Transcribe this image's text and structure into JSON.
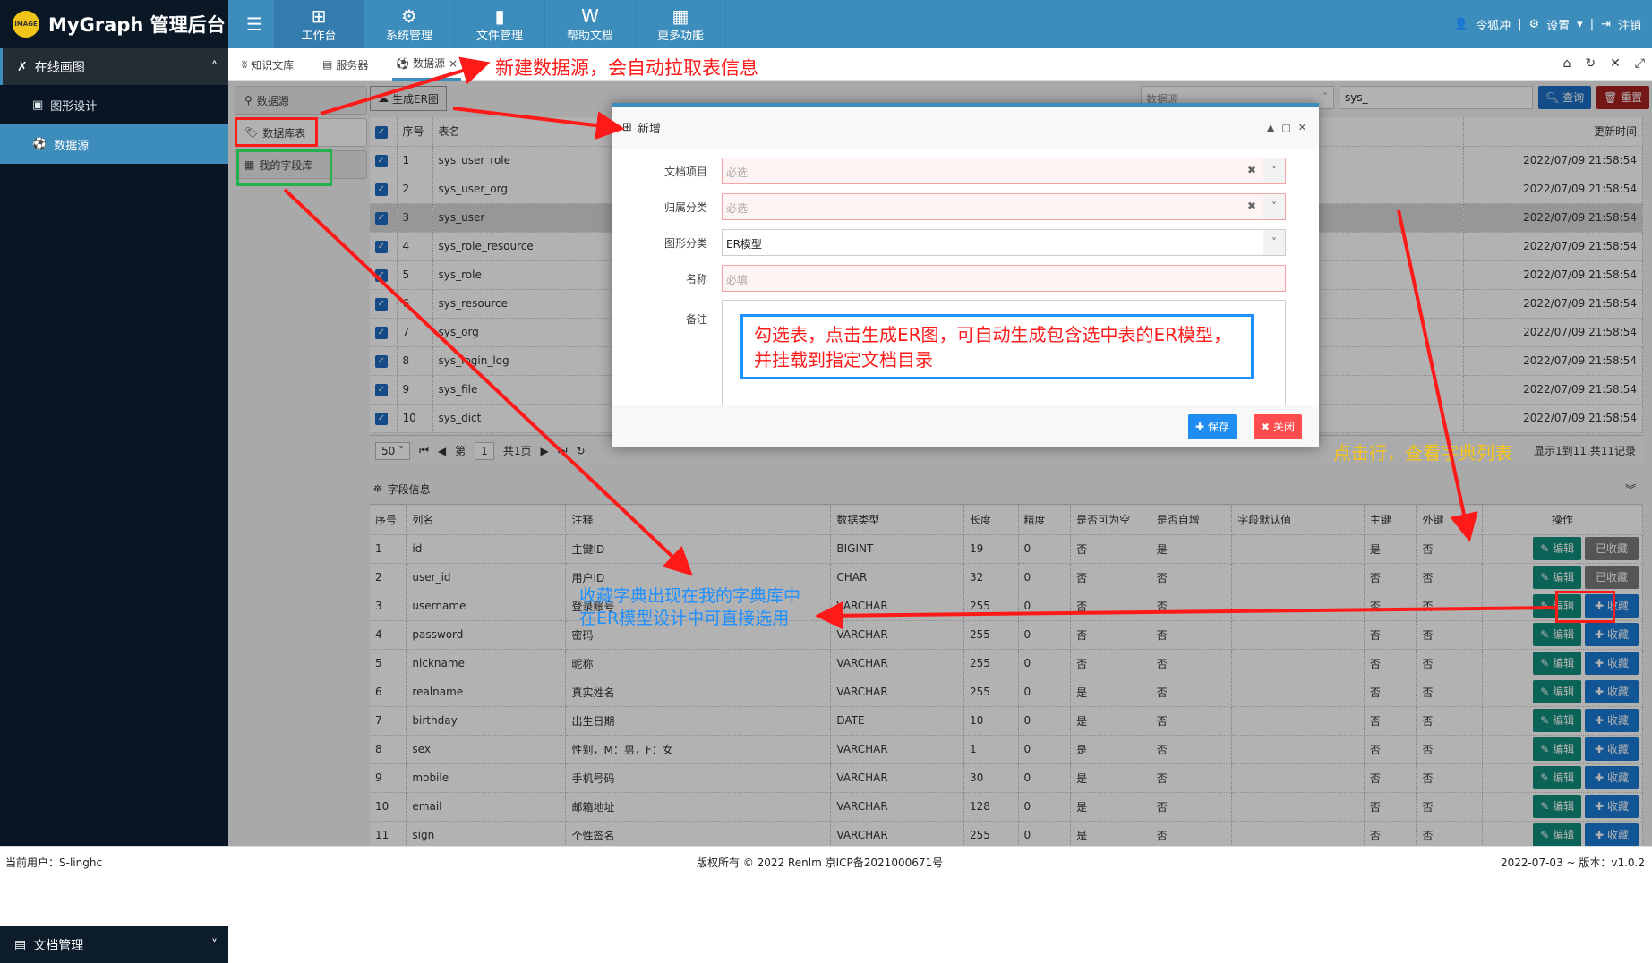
{
  "app": {
    "title": "MyGraph 管理后台",
    "logo_text": "IMAGE"
  },
  "topnav": [
    {
      "label": "工作台",
      "icon": "windows-icon"
    },
    {
      "label": "系统管理",
      "icon": "gear-icon"
    },
    {
      "label": "文件管理",
      "icon": "file-icon"
    },
    {
      "label": "帮助文档",
      "icon": "word-doc-icon"
    },
    {
      "label": "更多功能",
      "icon": "grid-icon"
    }
  ],
  "userbar": {
    "user": "令狐冲",
    "settings": "设置",
    "logout": "注销"
  },
  "sidebar": {
    "section": "在线画图",
    "items": [
      "图形设计",
      "数据源"
    ],
    "bottom": "文档管理"
  },
  "tabs": [
    {
      "label": "知识文库"
    },
    {
      "label": "服务器"
    },
    {
      "label": "数据源"
    }
  ],
  "lefttabs": [
    "数据源",
    "数据库表",
    "我的字段库"
  ],
  "toolbar": {
    "gen_er": "生成ER图",
    "ds_placeholder": "数据源",
    "search_value": "sys_",
    "query": "查询",
    "reset": "重置"
  },
  "table_cols": {
    "no": "序号",
    "name": "表名",
    "updated": "更新时间"
  },
  "tables": [
    {
      "no": "1",
      "name": "sys_user_role",
      "updated": "2022/07/09 21:58:54"
    },
    {
      "no": "2",
      "name": "sys_user_org",
      "updated": "2022/07/09 21:58:54"
    },
    {
      "no": "3",
      "name": "sys_user",
      "updated": "2022/07/09 21:58:54"
    },
    {
      "no": "4",
      "name": "sys_role_resource",
      "updated": "2022/07/09 21:58:54"
    },
    {
      "no": "5",
      "name": "sys_role",
      "updated": "2022/07/09 21:58:54"
    },
    {
      "no": "6",
      "name": "sys_resource",
      "updated": "2022/07/09 21:58:54"
    },
    {
      "no": "7",
      "name": "sys_org",
      "updated": "2022/07/09 21:58:54"
    },
    {
      "no": "8",
      "name": "sys_login_log",
      "updated": "2022/07/09 21:58:54"
    },
    {
      "no": "9",
      "name": "sys_file",
      "updated": "2022/07/09 21:58:54"
    },
    {
      "no": "10",
      "name": "sys_dict",
      "updated": "2022/07/09 21:58:54"
    }
  ],
  "pager": {
    "size": "50",
    "page_prefix": "第",
    "page": "1",
    "total": "共1页",
    "summary": "显示1到11,共11记录"
  },
  "fields_title": "字段信息",
  "field_cols": [
    "序号",
    "列名",
    "注释",
    "数据类型",
    "长度",
    "精度",
    "是否可为空",
    "是否自增",
    "字段默认值",
    "主键",
    "外键",
    "操作"
  ],
  "fields": [
    [
      "1",
      "id",
      "主键ID",
      "BIGINT",
      "19",
      "0",
      "否",
      "是",
      "",
      "是",
      "否",
      "已收藏"
    ],
    [
      "2",
      "user_id",
      "用户ID",
      "CHAR",
      "32",
      "0",
      "否",
      "否",
      "",
      "否",
      "否",
      "已收藏"
    ],
    [
      "3",
      "username",
      "登录账号",
      "VARCHAR",
      "255",
      "0",
      "否",
      "否",
      "",
      "否",
      "否",
      "收藏"
    ],
    [
      "4",
      "password",
      "密码",
      "VARCHAR",
      "255",
      "0",
      "否",
      "否",
      "",
      "否",
      "否",
      "收藏"
    ],
    [
      "5",
      "nickname",
      "昵称",
      "VARCHAR",
      "255",
      "0",
      "否",
      "否",
      "",
      "否",
      "否",
      "收藏"
    ],
    [
      "6",
      "realname",
      "真实姓名",
      "VARCHAR",
      "255",
      "0",
      "是",
      "否",
      "",
      "否",
      "否",
      "收藏"
    ],
    [
      "7",
      "birthday",
      "出生日期",
      "DATE",
      "10",
      "0",
      "是",
      "否",
      "",
      "否",
      "否",
      "收藏"
    ],
    [
      "8",
      "sex",
      "性别，M：男，F：女",
      "VARCHAR",
      "1",
      "0",
      "是",
      "否",
      "",
      "否",
      "否",
      "收藏"
    ],
    [
      "9",
      "mobile",
      "手机号码",
      "VARCHAR",
      "30",
      "0",
      "是",
      "否",
      "",
      "否",
      "否",
      "收藏"
    ],
    [
      "10",
      "email",
      "邮箱地址",
      "VARCHAR",
      "128",
      "0",
      "是",
      "否",
      "",
      "否",
      "否",
      "收藏"
    ],
    [
      "11",
      "sign",
      "个性签名",
      "VARCHAR",
      "255",
      "0",
      "是",
      "否",
      "",
      "否",
      "否",
      "收藏"
    ]
  ],
  "edit_label": "编辑",
  "modal": {
    "title": "新增",
    "fields": [
      {
        "label": "文档项目",
        "placeholder": "必选"
      },
      {
        "label": "归属分类",
        "placeholder": "必选"
      },
      {
        "label": "图形分类",
        "value": "ER模型"
      },
      {
        "label": "名称",
        "placeholder": "必填"
      }
    ],
    "remark_label": "备注",
    "save": "保存",
    "close": "关闭"
  },
  "annotations": {
    "new_ds": "新建数据源，会自动拉取表信息",
    "gen_er": "勾选表，点击生成ER图，可自动生成包含选中表的ER模型，",
    "gen_er2": "并挂载到指定文档目录",
    "click_row": "点击行，查看字典列表",
    "fav1": "收藏字典出现在我的字典库中",
    "fav2": "在ER模型设计中可直接选用"
  },
  "footer": {
    "user": "当前用户：S-linghc",
    "copyright": "版权所有 © 2022 Renlm",
    "icp": "京ICP备2021000671号",
    "version": "2022-07-03 ~ 版本：v1.0.2"
  },
  "colors": {
    "primary": "#3c8dbc",
    "danger": "#ff4d4f",
    "annotation_red": "#ff1a1a",
    "annotation_blue": "#1e90ff",
    "annotation_yellow": "#f5c518"
  }
}
